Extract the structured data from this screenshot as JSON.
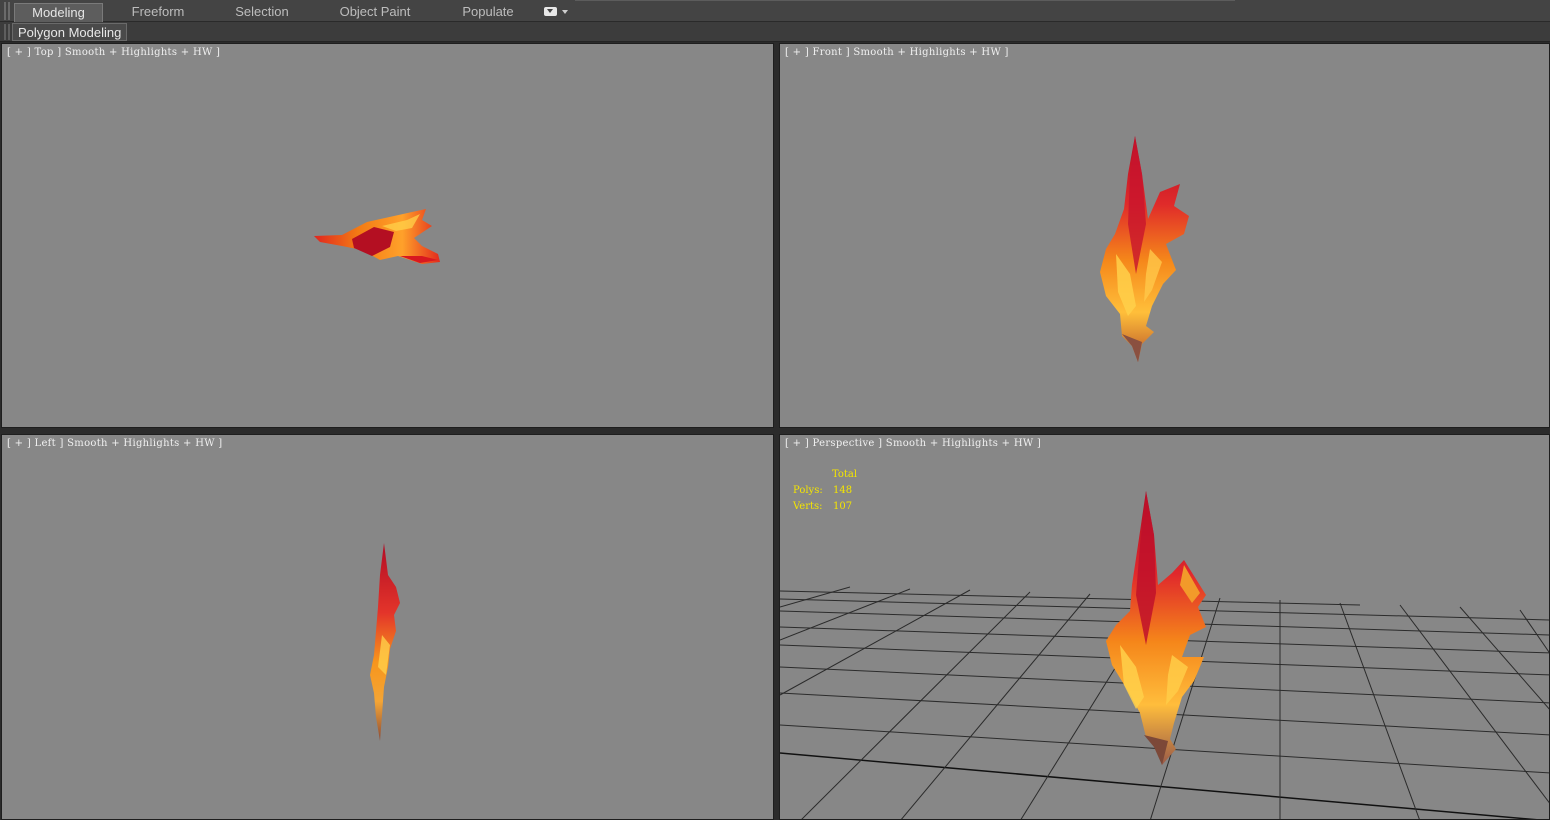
{
  "ribbon": {
    "tabs": [
      {
        "label": "Modeling",
        "active": true
      },
      {
        "label": "Freeform",
        "active": false
      },
      {
        "label": "Selection",
        "active": false
      },
      {
        "label": "Object Paint",
        "active": false
      },
      {
        "label": "Populate",
        "active": false
      }
    ],
    "dropdown_icon": "ribbon-options-icon"
  },
  "subpanel": {
    "label": "Polygon Modeling"
  },
  "viewports": {
    "top": {
      "label": "[ + ] Top ] Smooth + Highlights + HW ]"
    },
    "front": {
      "label": "[ + ] Front ] Smooth + Highlights + HW ]"
    },
    "left": {
      "label": "[ + ] Left ] Smooth + Highlights + HW ]"
    },
    "perspective": {
      "label": "[ + ] Perspective ] Smooth + Highlights + HW ]",
      "stats": {
        "title": "Total",
        "polys_label": "Polys:",
        "polys_value": "148",
        "verts_label": "Verts:",
        "verts_value": "107"
      }
    }
  },
  "colors": {
    "viewport_bg": "#878787",
    "stats_text": "#f4e500",
    "grid_line": "#2a2a2a",
    "model_red": "#c4122a",
    "model_orange": "#f07a10",
    "model_yellow": "#ffd24a"
  }
}
